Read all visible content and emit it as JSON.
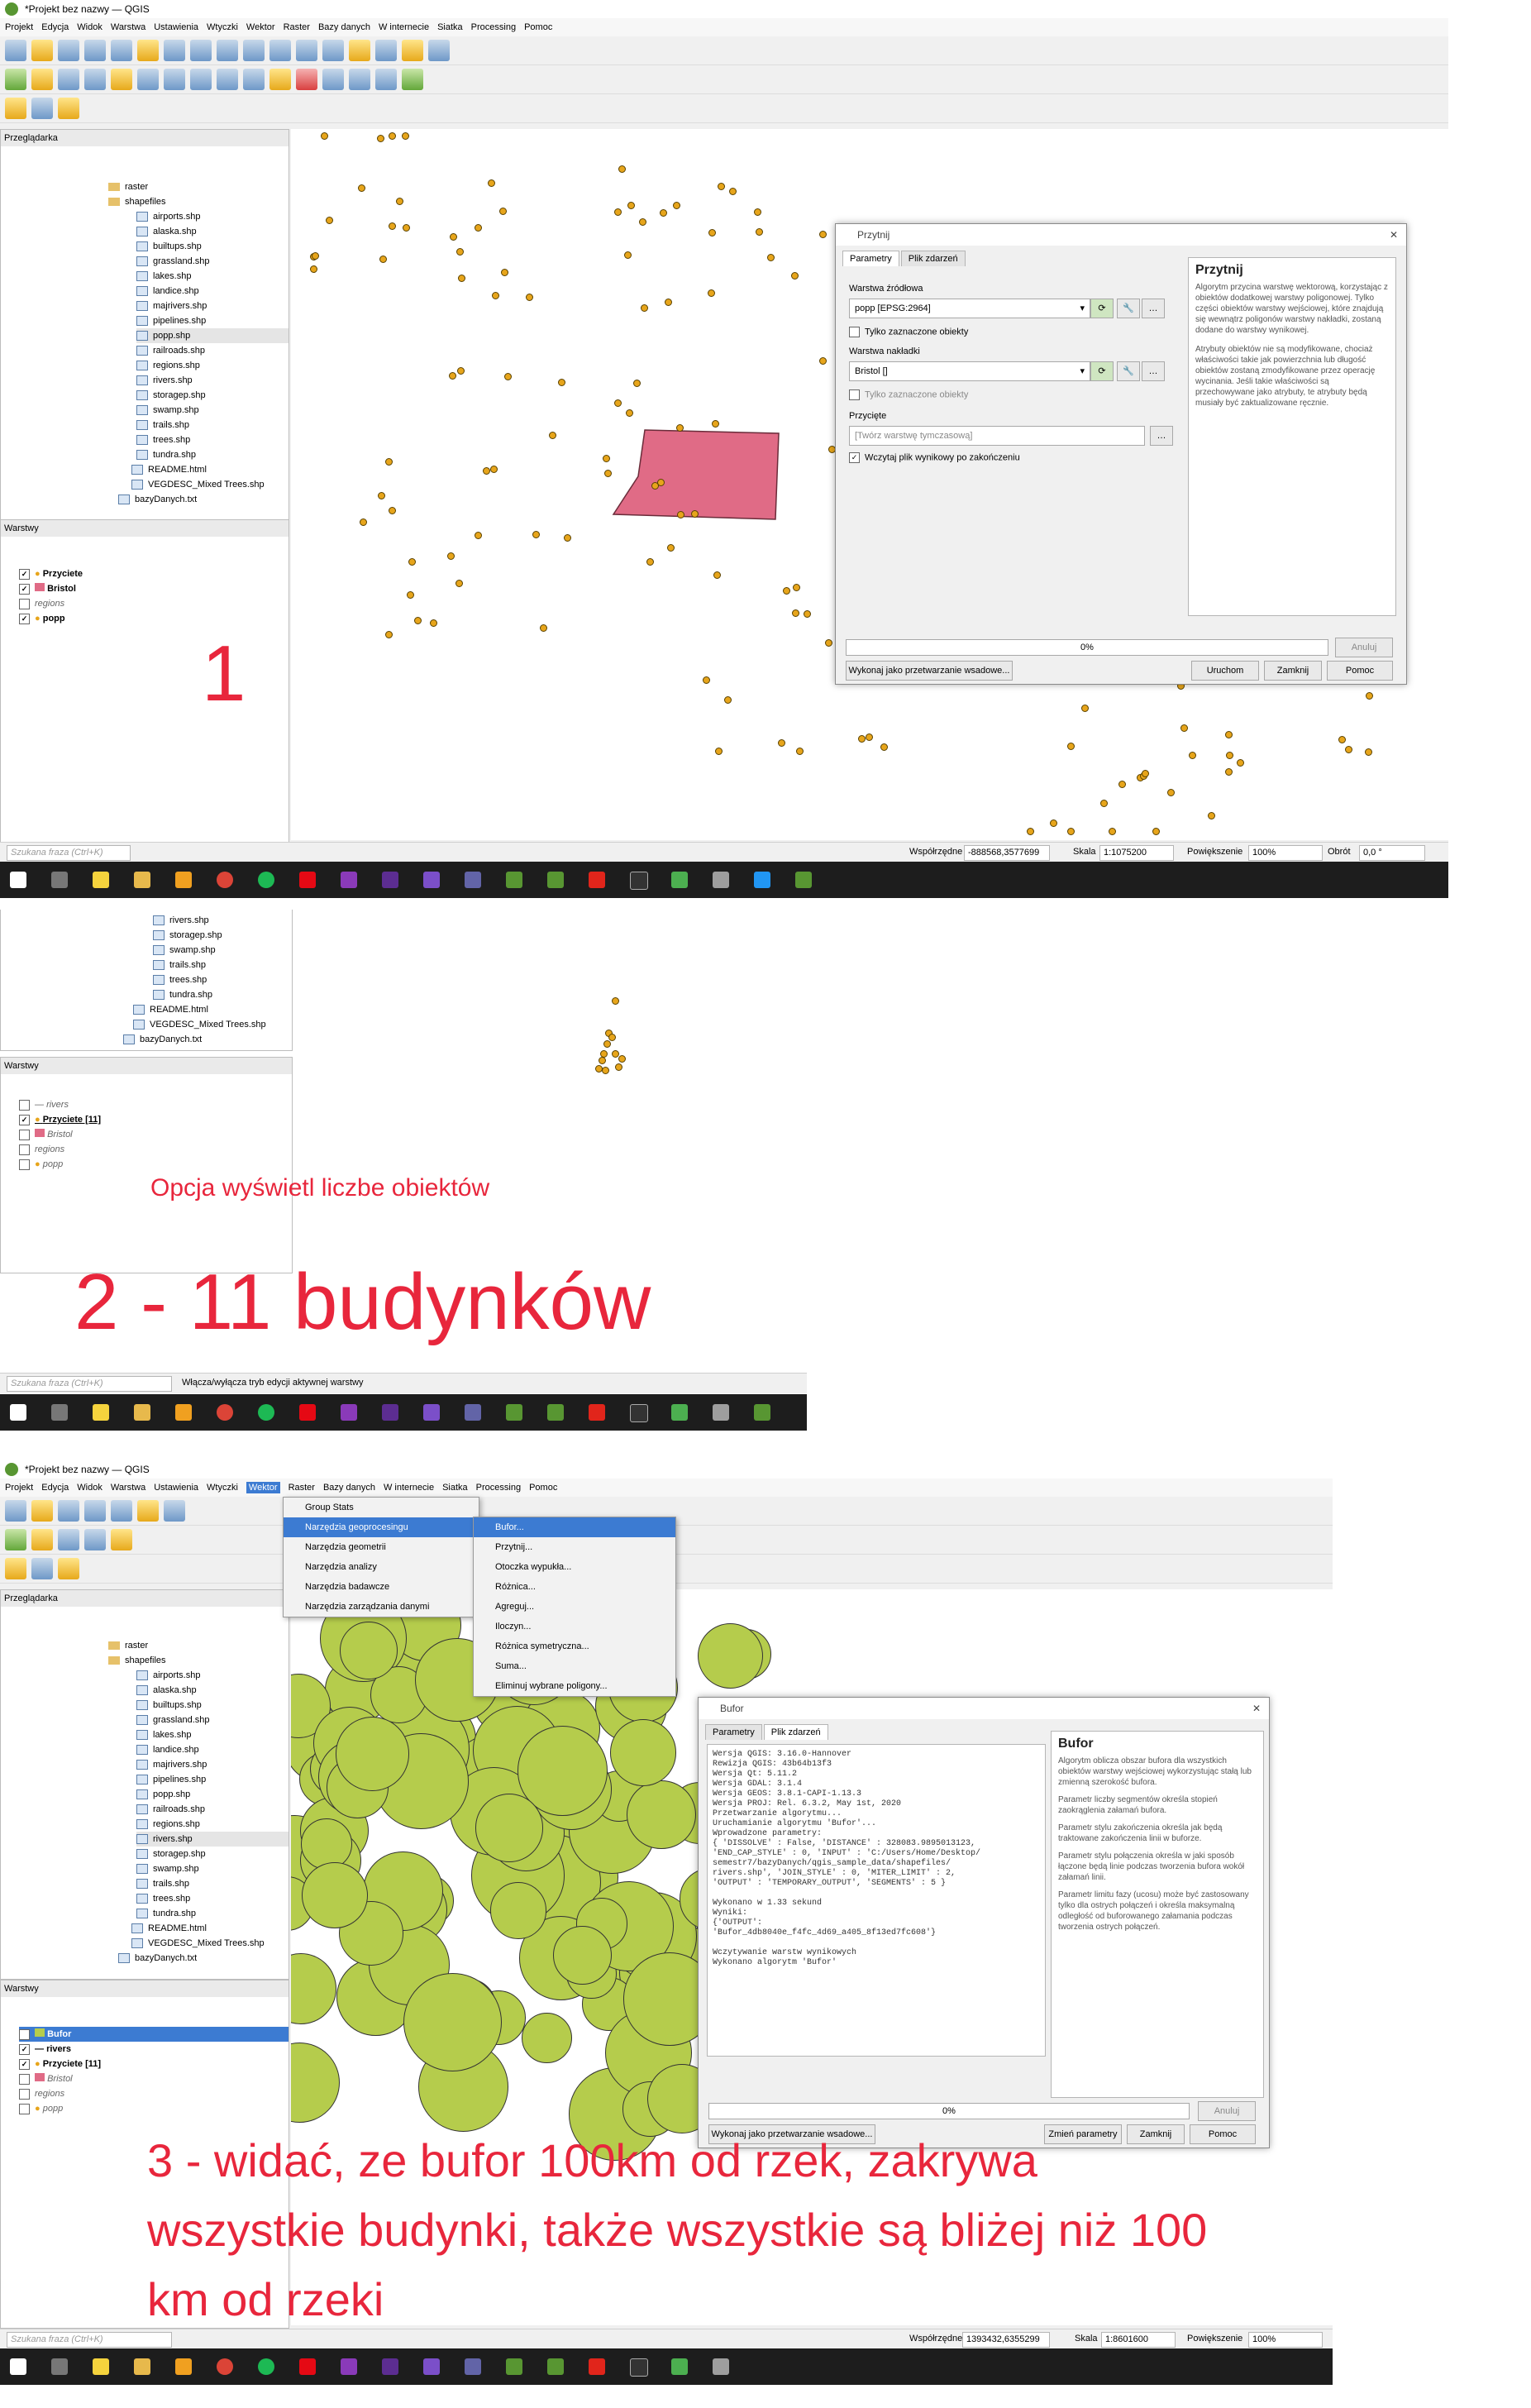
{
  "app": {
    "window_title": "*Projekt bez nazwy — QGIS"
  },
  "menus": [
    "Projekt",
    "Edycja",
    "Widok",
    "Warstwa",
    "Ustawienia",
    "Wtyczki",
    "Wektor",
    "Raster",
    "Bazy danych",
    "W internecie",
    "Siatka",
    "Processing",
    "Pomoc"
  ],
  "browser": {
    "title": "Przeglądarka",
    "items": [
      "raster",
      "shapefiles",
      "airports.shp",
      "alaska.shp",
      "builtups.shp",
      "grassland.shp",
      "lakes.shp",
      "landice.shp",
      "majrivers.shp",
      "pipelines.shp",
      "popp.shp",
      "railroads.shp",
      "regions.shp",
      "rivers.shp",
      "storagep.shp",
      "swamp.shp",
      "trails.shp",
      "trees.shp",
      "tundra.shp",
      "README.html",
      "VEGDESC_Mixed Trees.shp",
      "bazyDanych.txt"
    ]
  },
  "layers_panel": {
    "title": "Warstwy",
    "s1": [
      "Przyciete",
      "Bristol",
      "regions",
      "popp"
    ],
    "s2": [
      "rivers",
      "Przyciete [11]",
      "Bristol",
      "regions",
      "popp"
    ],
    "s3": [
      "Bufor",
      "rivers",
      "Przyciete [11]",
      "Bristol",
      "regions",
      "popp"
    ]
  },
  "clip_dialog": {
    "title": "Przytnij",
    "tab_params": "Parametry",
    "tab_log": "Plik zdarzeń",
    "source_label": "Warstwa źródłowa",
    "source_value": "popp [EPSG:2964]",
    "only_selected_1": "Tylko zaznaczone obiekty",
    "overlay_label": "Warstwa nakładki",
    "overlay_value": "Bristol []",
    "only_selected_2": "Tylko zaznaczone obiekty",
    "output_label": "Przycięte",
    "output_placeholder": "[Twórz warstwę tymczasową]",
    "open_output": "Wczytaj plik wynikowy po zakończeniu",
    "help_title": "Przytnij",
    "help_p1": "Algorytm przycina warstwę wektorową, korzystając z obiektów dodatkowej warstwy poligonowej. Tylko części obiektów warstwy wejściowej, które znajdują się wewnątrz poligonów warstwy nakładki, zostaną dodane do warstwy wynikowej.",
    "help_p2": "Atrybuty obiektów nie są modyfikowane, chociaż właściwości takie jak powierzchnia lub długość obiektów zostaną zmodyfikowane przez operację wycinania. Jeśli takie właściwości są przechowywane jako atrybuty, te atrybuty będą musiały być zaktualizowane ręcznie.",
    "progress": "0%",
    "cancel": "Anuluj",
    "batch": "Wykonaj jako przetwarzanie wsadowe...",
    "run": "Uruchom",
    "close": "Zamknij",
    "help": "Pomoc"
  },
  "status1": {
    "search_placeholder": "Szukana fraza (Ctrl+K)",
    "coord_label": "Współrzędne",
    "coord_value": "-888568,3577699",
    "scale_label": "Skala",
    "scale_value": "1:1075200",
    "mag_label": "Powiększenie",
    "mag_value": "100%",
    "rot_label": "Obrót",
    "rot_value": "0,0 °"
  },
  "status2": {
    "search_placeholder": "Szukana fraza (Ctrl+K)",
    "hint": "Włącza/wyłącza tryb edycji aktywnej warstwy"
  },
  "status3": {
    "search_placeholder": "Szukana fraza (Ctrl+K)",
    "coord_label": "Współrzędne",
    "coord_value": "1393432,6355299",
    "scale_label": "Skala",
    "scale_value": "1:8601600",
    "mag_label": "Powiększenie",
    "mag_value": "100%"
  },
  "vector_menu": {
    "items": [
      "Group Stats",
      "Narzędzia geoprocesingu",
      "Narzędzia geometrii",
      "Narzędzia analizy",
      "Narzędzia badawcze",
      "Narzędzia zarządzania danymi"
    ],
    "sub": [
      "Bufor...",
      "Przytnij...",
      "Otoczka wypukła...",
      "Różnica...",
      "Agreguj...",
      "Iloczyn...",
      "Różnica symetryczna...",
      "Suma...",
      "Eliminuj wybrane poligony..."
    ]
  },
  "buffer_dialog": {
    "title": "Bufor",
    "tab_params": "Parametry",
    "tab_log": "Plik zdarzeń",
    "log": "Wersja QGIS: 3.16.0-Hannover\nRewizja QGIS: 43b64b13f3\nWersja Qt: 5.11.2\nWersja GDAL: 3.1.4\nWersja GEOS: 3.8.1-CAPI-1.13.3\nWersja PROJ: Rel. 6.3.2, May 1st, 2020\nPrzetwarzanie algorytmu...\nUruchamianie algorytmu 'Bufor'...\nWprowadzone parametry:\n{ 'DISSOLVE' : False, 'DISTANCE' : 328083.9895013123,\n'END_CAP_STYLE' : 0, 'INPUT' : 'C:/Users/Home/Desktop/\nsemestr7/bazyDanych/qgis_sample_data/shapefiles/\nrivers.shp', 'JOIN_STYLE' : 0, 'MITER_LIMIT' : 2,\n'OUTPUT' : 'TEMPORARY_OUTPUT', 'SEGMENTS' : 5 }\n\nWykonano w 1.33 sekund\nWyniki:\n{'OUTPUT':\n'Bufor_4db8040e_f4fc_4d69_a405_8f13ed7fc608'}\n\nWczytywanie warstw wynikowych\nWykonano algorytm 'Bufor'",
    "help_title": "Bufor",
    "help_p1": "Algorytm oblicza obszar bufora dla wszystkich obiektów warstwy wejściowej wykorzystując stałą lub zmienną szerokość bufora.",
    "help_p2": "Parametr liczby segmentów określa stopień zaokrąglenia załamań bufora.",
    "help_p3": "Parametr stylu zakończenia określa jak będą traktowane zakończenia linii w buforze.",
    "help_p4": "Parametr stylu połączenia określa w jaki sposób łączone będą linie podczas tworzenia bufora wokół załamań linii.",
    "help_p5": "Parametr limitu fazy (ucosu) może być zastosowany tylko dla ostrych połączeń i określa maksymalną odległość od buforowanego załamania podczas tworzenia ostrych połączeń.",
    "progress": "0%",
    "cancel": "Anuluj",
    "batch": "Wykonaj jako przetwarzanie wsadowe...",
    "change": "Zmień parametry",
    "close": "Zamknij",
    "help": "Pomoc"
  },
  "annotations": {
    "n1": "1",
    "note2": "Opcja wyświetl liczbe obiektów",
    "n2": "2 - 11 budynków",
    "n3_line1": "3 - widać, ze bufor 100km od rzek, zakrywa",
    "n3_line2": "wszystkie budynki, także wszystkie są bliżej niż 100",
    "n3_line3": "km od rzeki"
  },
  "colors": {
    "accent": "#e8263c",
    "points": "#e7a51b",
    "polygon": "#e06b86",
    "buffer": "#b5cc4c",
    "taskbar": "#1d1d1d",
    "menu_highlight": "#3c7bd2"
  }
}
